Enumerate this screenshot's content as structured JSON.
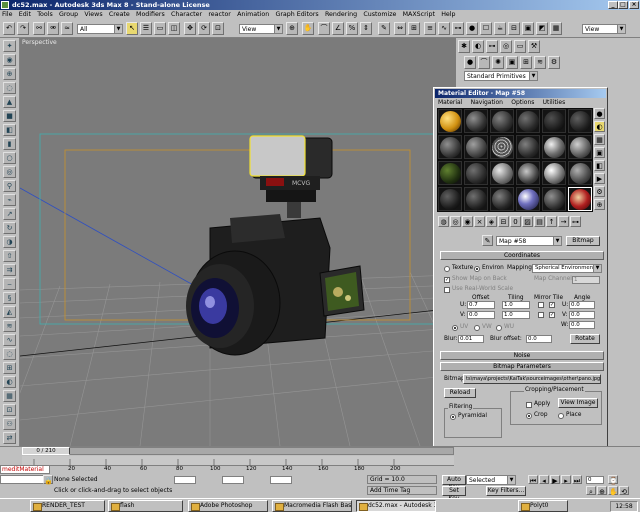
{
  "window": {
    "title": "dc52.max - Autodesk 3ds Max 8 - Stand-alone License",
    "min": "_",
    "max": "□",
    "close": "×"
  },
  "menu": [
    "File",
    "Edit",
    "Tools",
    "Group",
    "Views",
    "Create",
    "Modifiers",
    "Character",
    "reactor",
    "Animation",
    "Graph Editors",
    "Rendering",
    "Customize",
    "MAXScript",
    "Help"
  ],
  "toolbar": {
    "selection_filter": "All",
    "ref_coord": "View",
    "named_sel": "View"
  },
  "viewport": {
    "label": "Perspective"
  },
  "command_panel": {
    "category": "Standard Primitives"
  },
  "material_editor": {
    "title": "Material Editor - Map #58",
    "menu": [
      "Material",
      "Navigation",
      "Options",
      "Utilities"
    ],
    "map_name": "Map #58",
    "map_type": "Bitmap",
    "rollouts": {
      "coordinates": "Coordinates",
      "noise": "Noise",
      "bitmap_params": "Bitmap Parameters"
    },
    "coords": {
      "texture": "Texture",
      "environ": "Environ",
      "mapping_label": "Mapping:",
      "mapping": "Spherical Environment",
      "show_map_on_back": "Show Map on Back",
      "map_channel": "Map Channel:",
      "map_channel_value": "1",
      "use_real_world": "Use Real-World Scale",
      "offset": "Offset",
      "tiling": "Tiling",
      "mirror_tile": "Mirror Tile",
      "angle": "Angle",
      "u": "U:",
      "v": "V:",
      "w": "W:",
      "u_offset": "0.7",
      "v_offset": "0.0",
      "u_tiling": "1.0",
      "v_tiling": "1.0",
      "u_angle": "0.0",
      "v_angle": "0.0",
      "w_angle": "0.0",
      "uv": "UV",
      "vw": "VW",
      "wu": "WU",
      "blur": "Blur:",
      "blur_value": "0.01",
      "blur_offset": "Blur offset:",
      "blur_offset_value": "0.0",
      "rotate": "Rotate"
    },
    "bitmap": {
      "label": "Bitmap:",
      "path": "ts\\maya\\projects\\KaiTak\\sourceimages\\other\\pano.jpg",
      "reload": "Reload",
      "cropping": "Cropping/Placement",
      "apply": "Apply",
      "view_image": "View Image",
      "crop": "Crop",
      "place": "Place",
      "filtering": "Filtering",
      "pyramidal": "Pyramidal"
    }
  },
  "timeline": {
    "slider": "0 / 210",
    "ticks": [
      "0",
      "20",
      "40",
      "60",
      "80",
      "100",
      "120",
      "140",
      "160",
      "180",
      "200"
    ]
  },
  "status": {
    "listener": "meditMaterial",
    "selected": "None Selected",
    "prompt": "Click or click-and-drag to select objects",
    "grid": "Grid = 10.0",
    "add_time_tag": "Add Time Tag",
    "auto_key": "Auto Key",
    "set_key": "Set Key",
    "selected_combo": "Selected",
    "key_filters": "Key Filters...",
    "frame": "0"
  },
  "taskbar": {
    "items": [
      "RENDER_TEST",
      "flash",
      "Adobe Photoshop",
      "Macromedia Flash Basic 8...",
      "dc52.max - Autodesk 3ds M...",
      "Polyt0"
    ],
    "clock": "12:58"
  },
  "colors": {
    "title_start": "#0a246a",
    "title_end": "#a6caf0",
    "viewport_bg": "#7b7b7b",
    "grid": "#9a9a9a",
    "frame_orange": "#c8922a",
    "frame_cyan": "#40b0b0"
  }
}
